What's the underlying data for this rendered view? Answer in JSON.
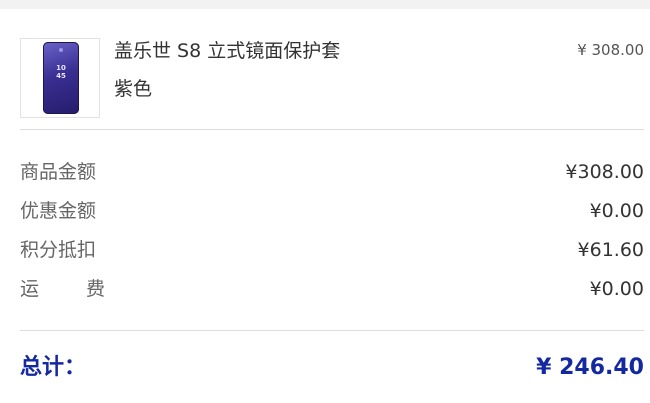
{
  "product": {
    "name": "盖乐世 S8 立式镜面保护套",
    "variant": "紫色",
    "price": "¥ 308.00",
    "thumb_clock": "10\n45"
  },
  "summary": [
    {
      "label": "商品金额",
      "value": "¥308.00"
    },
    {
      "label": "优惠金额",
      "value": "¥0.00"
    },
    {
      "label": "积分抵扣",
      "value": "¥61.60"
    },
    {
      "label_a": "运",
      "label_b": "费",
      "value": "¥0.00"
    }
  ],
  "total": {
    "label": "总计：",
    "value": "¥ 246.40"
  },
  "colors": {
    "accent": "#1428a0",
    "divider": "#dddddd",
    "label": "#666666"
  }
}
